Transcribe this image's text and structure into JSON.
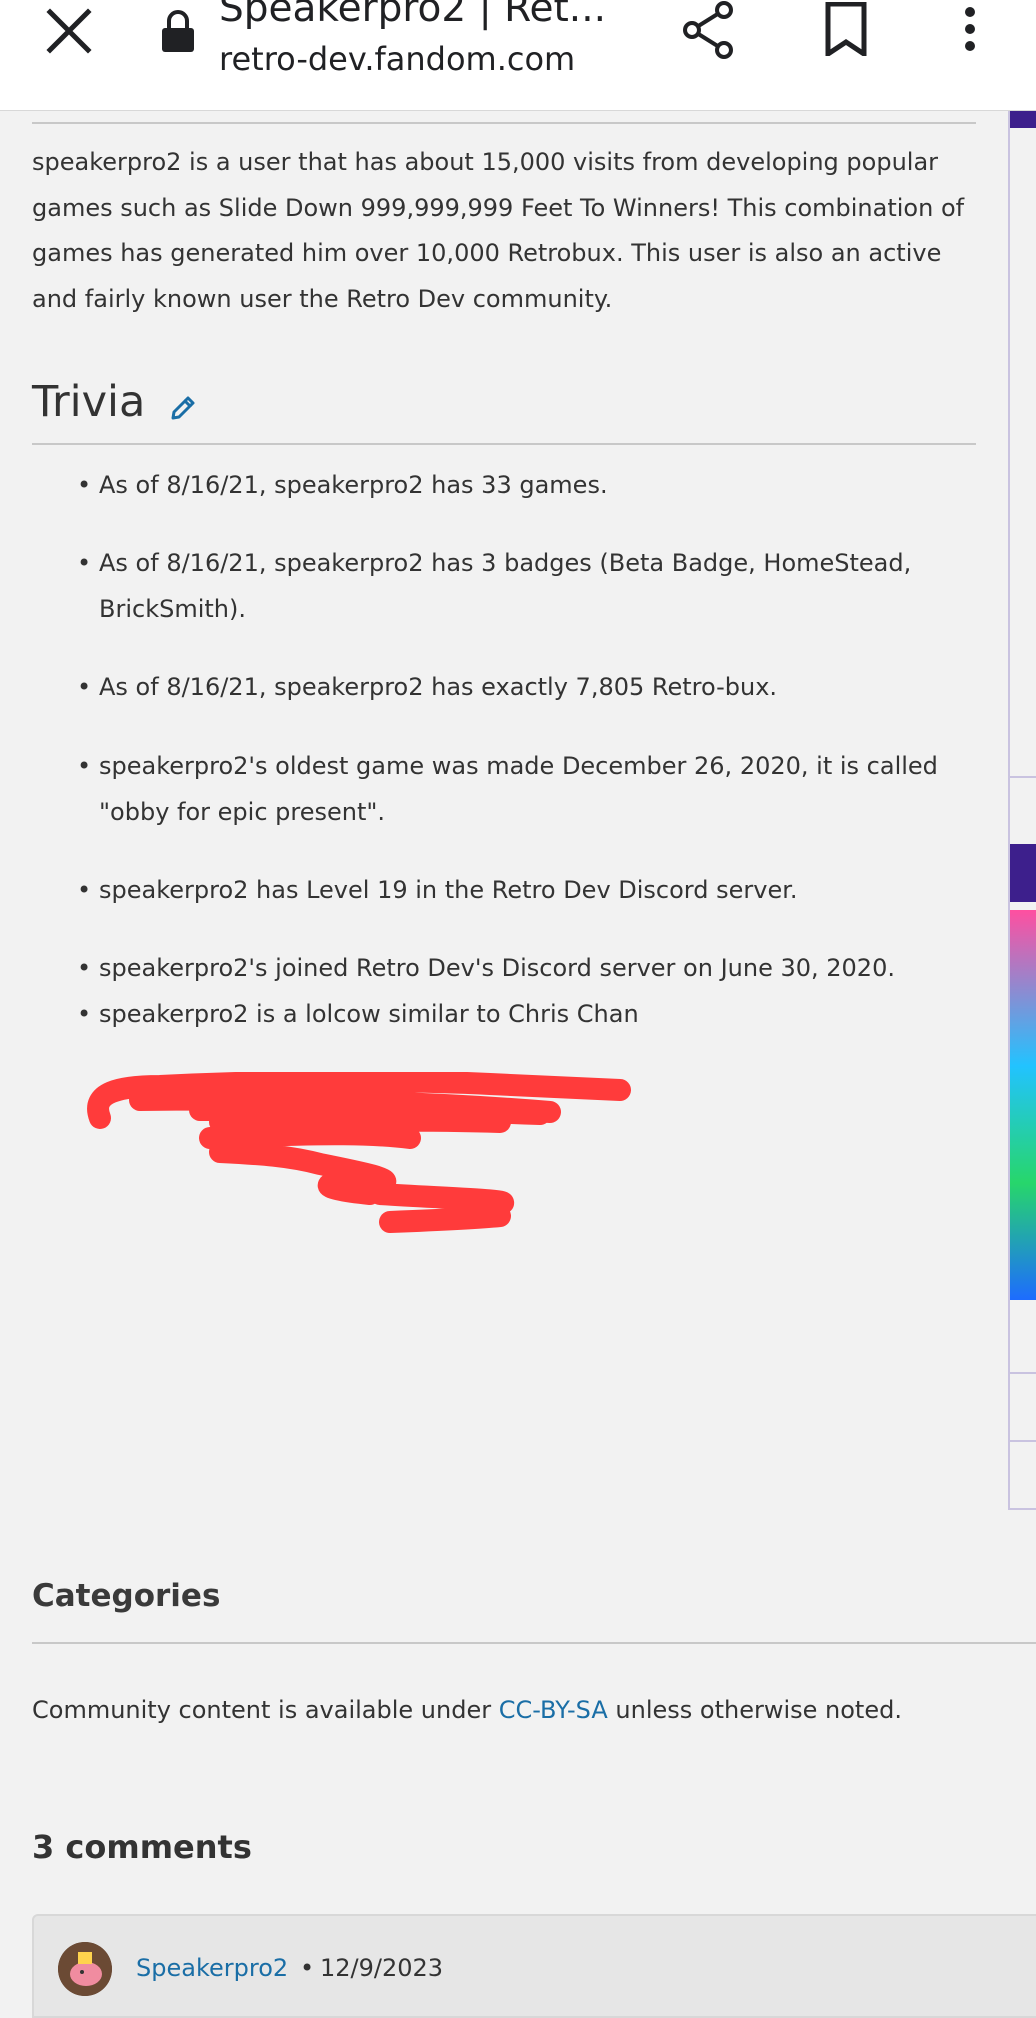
{
  "browser": {
    "title": "Speakerpro2 | Ret...",
    "url": "retro-dev.fandom.com",
    "icons": [
      "close-icon",
      "lock-icon",
      "share-icon",
      "bookmark-icon",
      "more-vertical-icon"
    ]
  },
  "article": {
    "intro": "speakerpro2 is a user that has about 15,000 visits from developing popular games such as Slide Down 999,999,999 Feet To Winners! This combination of games has generated him over 10,000 Retrobux. This user is also an active and fairly known user the Retro Dev community.",
    "trivia_heading": "Trivia",
    "trivia": [
      "As of 8/16/21, speakerpro2 has 33 games.",
      "As of 8/16/21, speakerpro2 has 3 badges (Beta Badge, HomeStead, BrickSmith).",
      "As of 8/16/21, speakerpro2 has exactly 7,805 Retro-bux.",
      "speakerpro2's oldest game was made December 26, 2020, it is called \"obby for epic present\".",
      "speakerpro2 has Level 19 in the Retro Dev Discord server.",
      "speakerpro2's joined Retro Dev's Discord server on June 30, 2020.",
      "speakerpro2 is a lolcow similar to Chris Chan"
    ],
    "bullet": "•"
  },
  "footer": {
    "categories_heading": "Categories",
    "license_prefix": "Community content is available under ",
    "license_link": "CC-BY-SA",
    "license_suffix": " unless otherwise noted."
  },
  "comments": {
    "heading": "3 comments",
    "items": [
      {
        "author": "Speakerpro2",
        "separator": "•",
        "date": "12/9/2023"
      }
    ]
  },
  "colors": {
    "link": "#1a6ea6",
    "scribble": "#ff3b3b",
    "background": "#f2f2f2",
    "infobox_accent": "#3d1f8c"
  }
}
